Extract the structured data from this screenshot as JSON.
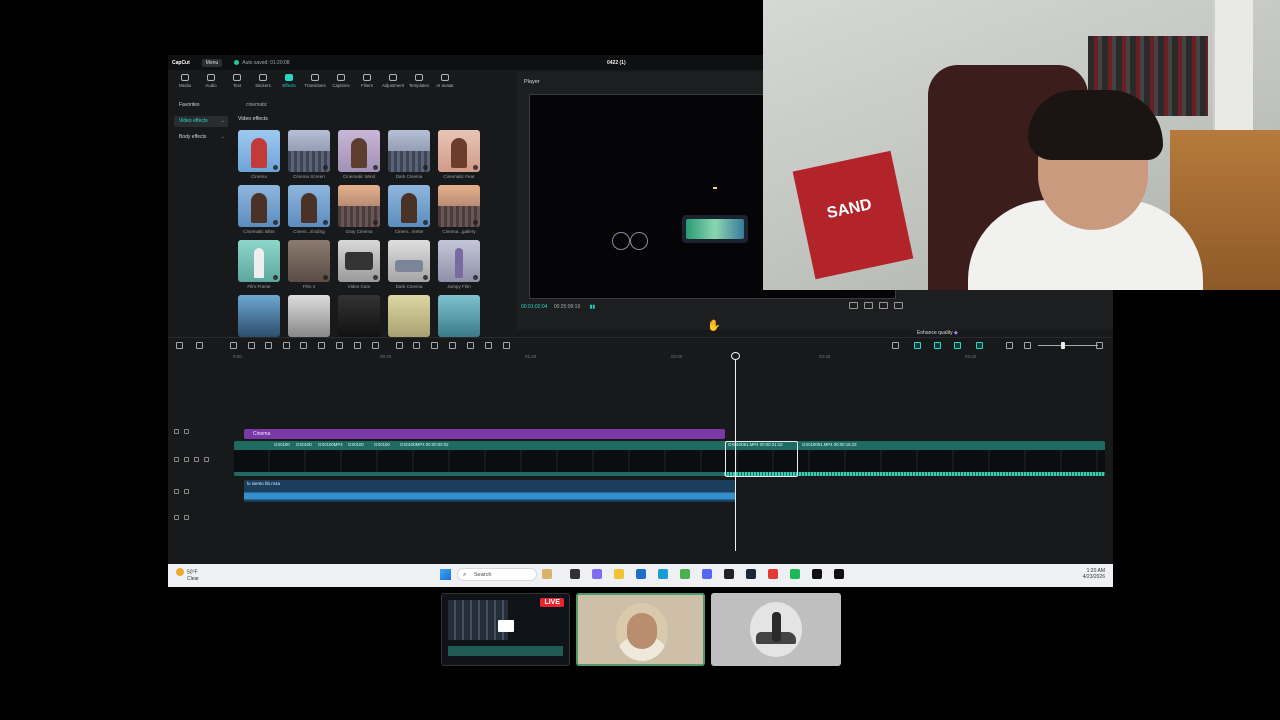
{
  "app": {
    "logo": "CapCut",
    "menu_label": "Menu",
    "autosave": "Auto saved: 01:20:08",
    "project_title": "0422 (1)"
  },
  "categories": [
    {
      "label": "Media",
      "icon": "media-icon"
    },
    {
      "label": "Audio",
      "icon": "audio-icon"
    },
    {
      "label": "Text",
      "icon": "text-icon"
    },
    {
      "label": "Stickers",
      "icon": "sticker-icon"
    },
    {
      "label": "Effects",
      "icon": "effects-icon",
      "active": true
    },
    {
      "label": "Transitions",
      "icon": "transition-icon"
    },
    {
      "label": "Captions",
      "icon": "captions-icon"
    },
    {
      "label": "Filters",
      "icon": "filter-icon"
    },
    {
      "label": "Adjustment",
      "icon": "adjust-icon"
    },
    {
      "label": "Templates",
      "icon": "template-icon"
    },
    {
      "label": "AI avatar",
      "icon": "avatar-icon"
    }
  ],
  "nav": {
    "favorites": "Favorites",
    "video_effects": "Video effects",
    "body_effects": "Body effects"
  },
  "search": {
    "query": "cinematic"
  },
  "effects": {
    "section_title": "Video effects",
    "items": [
      {
        "label": "Cinema"
      },
      {
        "label": "Cinema Screen"
      },
      {
        "label": "Cinematic Wind"
      },
      {
        "label": "Dark Cinema"
      },
      {
        "label": "Cinematic Fear"
      },
      {
        "label": "Cinematic Bliss"
      },
      {
        "label": "Cinem...Ending"
      },
      {
        "label": "Gray Cinema"
      },
      {
        "label": "Cinem...mette"
      },
      {
        "label": "Cinema...gallery"
      },
      {
        "label": "Film Frame"
      },
      {
        "label": "Film 4"
      },
      {
        "label": "Video Cam"
      },
      {
        "label": "Dark Cinema"
      },
      {
        "label": "Jumpy Film"
      },
      {
        "label": ""
      },
      {
        "label": ""
      },
      {
        "label": ""
      },
      {
        "label": ""
      },
      {
        "label": ""
      }
    ]
  },
  "player": {
    "title": "Player",
    "current_time": "00:01:02:04",
    "total_time": "00:25:09:19",
    "enhance_label": "Enhance quality"
  },
  "timeline": {
    "ruler": [
      "0:00",
      "00:40",
      "01:20",
      "02:00",
      "02:40",
      "03:20"
    ],
    "effect_clip": "Cinema",
    "video_labels": [
      "GX0100",
      "GX0100",
      "GX0100MP4",
      "GX0100",
      "GX0100",
      "GX0100MP4 00:00:00:02",
      "GX010061.MP4 00:00:21:10",
      "GX010061.MP4 00:00:16:23"
    ],
    "audio_clip": "lo siento bb.m4a"
  },
  "taskbar": {
    "weather_temp": "50°F",
    "weather_desc": "Clear",
    "search_placeholder": "Search",
    "time": "1:20 AM",
    "date": "4/23/2026"
  },
  "webcam": {
    "jersey_text": "SAND"
  },
  "participants": {
    "live_badge": "LIVE"
  }
}
